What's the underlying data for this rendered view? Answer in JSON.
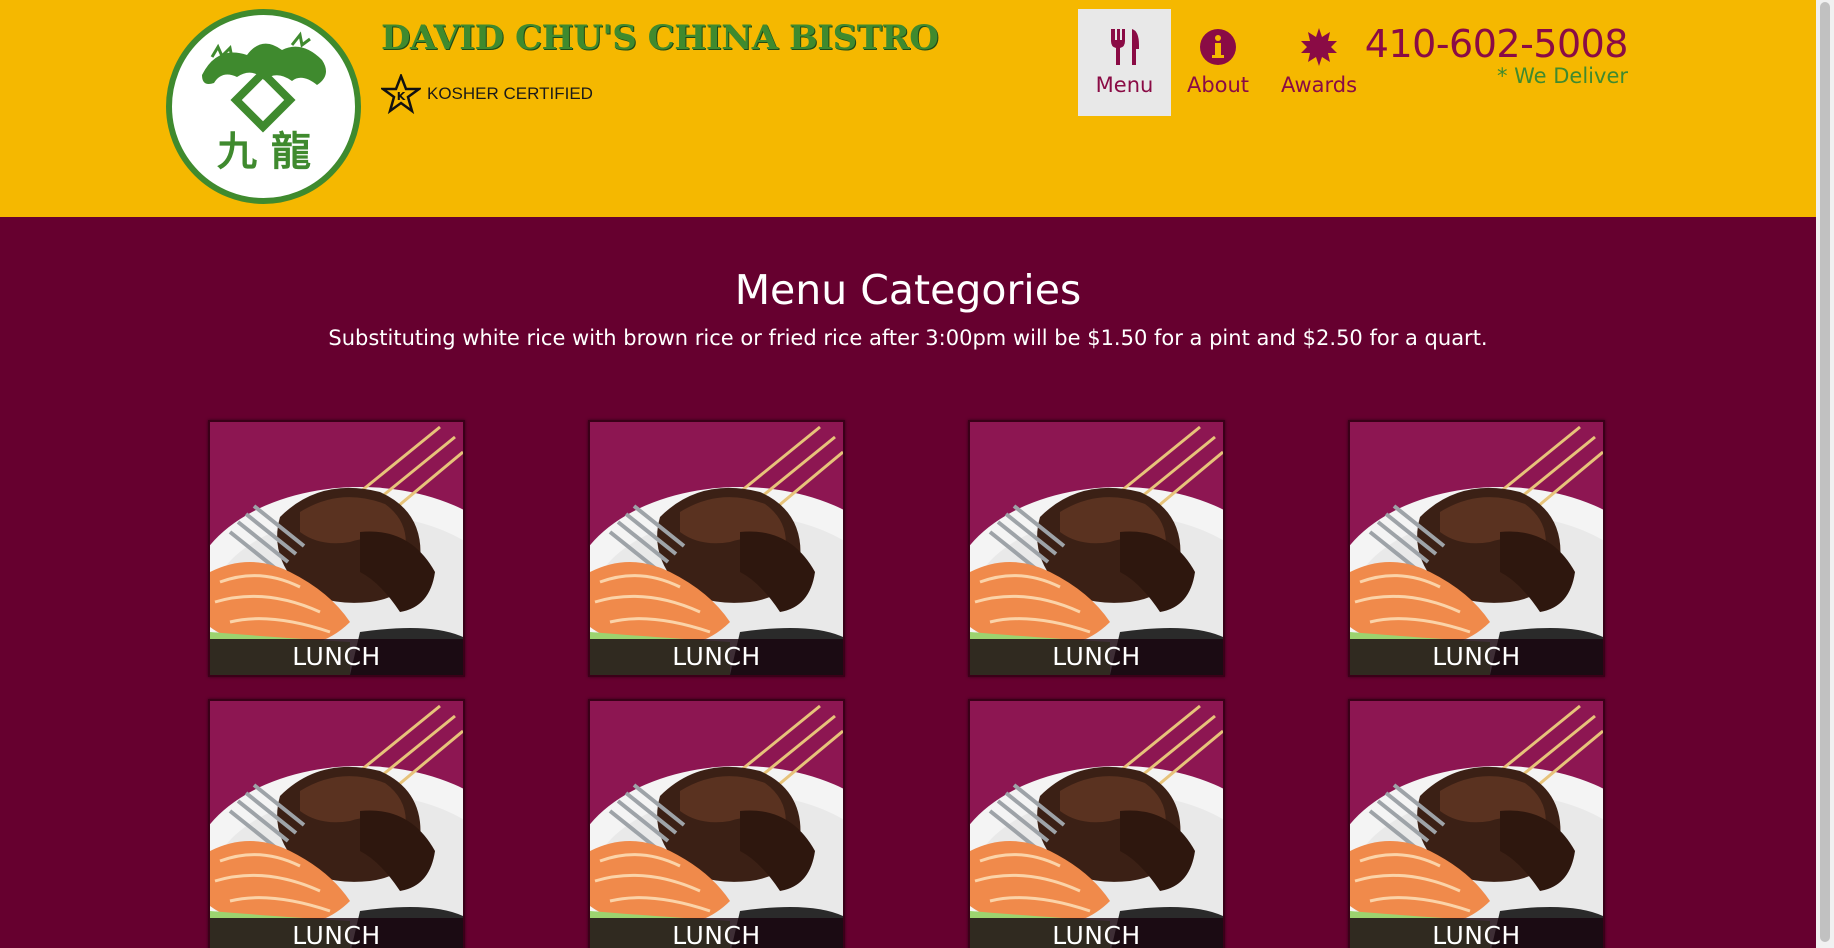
{
  "header": {
    "brand_title": "DAVID CHU'S CHINA BISTRO",
    "kosher_label": "KOSHER CERTIFIED",
    "phone": "410-602-5008",
    "deliver_note": "* We Deliver",
    "logo_glyphs": "九 龍"
  },
  "nav": {
    "items": [
      {
        "label": "Menu",
        "icon": "utensils-icon",
        "active": true
      },
      {
        "label": "About",
        "icon": "info-circle-icon",
        "active": false
      },
      {
        "label": "Awards",
        "icon": "burst-icon",
        "active": false
      }
    ]
  },
  "main": {
    "title": "Menu Categories",
    "note": "Substituting white rice with brown rice or fried rice after 3:00pm will be $1.50 for a pint and $2.50 for a quart."
  },
  "categories": [
    {
      "label": "LUNCH"
    },
    {
      "label": "LUNCH"
    },
    {
      "label": "LUNCH"
    },
    {
      "label": "LUNCH"
    },
    {
      "label": "LUNCH"
    },
    {
      "label": "LUNCH"
    },
    {
      "label": "LUNCH"
    },
    {
      "label": "LUNCH"
    }
  ],
  "colors": {
    "header_bg": "#f5b800",
    "page_bg": "#66002f",
    "accent": "#8a0b45",
    "green": "#3f8a2e"
  }
}
